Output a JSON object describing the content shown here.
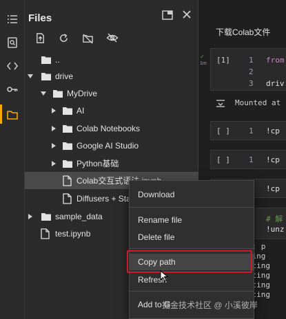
{
  "panel": {
    "title": "Files",
    "toolbar": [
      "upload-icon",
      "refresh-icon",
      "hide-drive-icon",
      "hide-files-icon"
    ]
  },
  "tree": [
    {
      "label": "..",
      "type": "folder",
      "expanded": null
    },
    {
      "label": "drive",
      "type": "folder",
      "expanded": true
    },
    {
      "label": "MyDrive",
      "type": "folder",
      "expanded": true
    },
    {
      "label": "AI",
      "type": "folder",
      "expanded": false
    },
    {
      "label": "Colab Notebooks",
      "type": "folder",
      "expanded": false
    },
    {
      "label": "Google AI Studio",
      "type": "folder",
      "expanded": false
    },
    {
      "label": "Python基础",
      "type": "folder",
      "expanded": false
    },
    {
      "label": "Colab交互式语法.ipynb",
      "type": "file",
      "selected": true
    },
    {
      "label": "Diffusers + Sta",
      "type": "file"
    },
    {
      "label": "sample_data",
      "type": "folder",
      "expanded": false
    },
    {
      "label": "test.ipynb",
      "type": "file"
    }
  ],
  "notebook": {
    "title": "下载Colab文件",
    "cells": [
      {
        "idx": "[1]",
        "status": "1m",
        "lines": [
          "1",
          "2",
          "3"
        ],
        "code": [
          "from",
          "",
          "driv"
        ]
      },
      {
        "idx": "[ ]",
        "lines": [
          "1"
        ],
        "code": [
          "!cp"
        ]
      },
      {
        "idx": "[ ]",
        "lines": [
          "1"
        ],
        "code": [
          "!cp"
        ]
      },
      {
        "idx": "",
        "lines": [
          "1"
        ],
        "code": [
          "!cp"
        ]
      },
      {
        "idx": "",
        "lines": [
          "1",
          "2"
        ],
        "code": [
          "# 解",
          "!unz"
        ]
      }
    ],
    "mounted": "Mounted at",
    "output": [
      "hive:  p",
      "reating",
      "nflating",
      "nflating",
      "nflating",
      "nflating"
    ]
  },
  "menu": {
    "items": [
      "Download",
      "Rename file",
      "Delete file",
      "Copy path",
      "Refresh",
      "Add to G"
    ],
    "highlighted": "Copy path"
  },
  "watermark": "掘金技术社区 @ 小溪彼岸",
  "colors": {
    "accent": "#f9ab00",
    "highlight": "#d0192a",
    "keyword": "#c586c0",
    "string": "#ce9178"
  }
}
